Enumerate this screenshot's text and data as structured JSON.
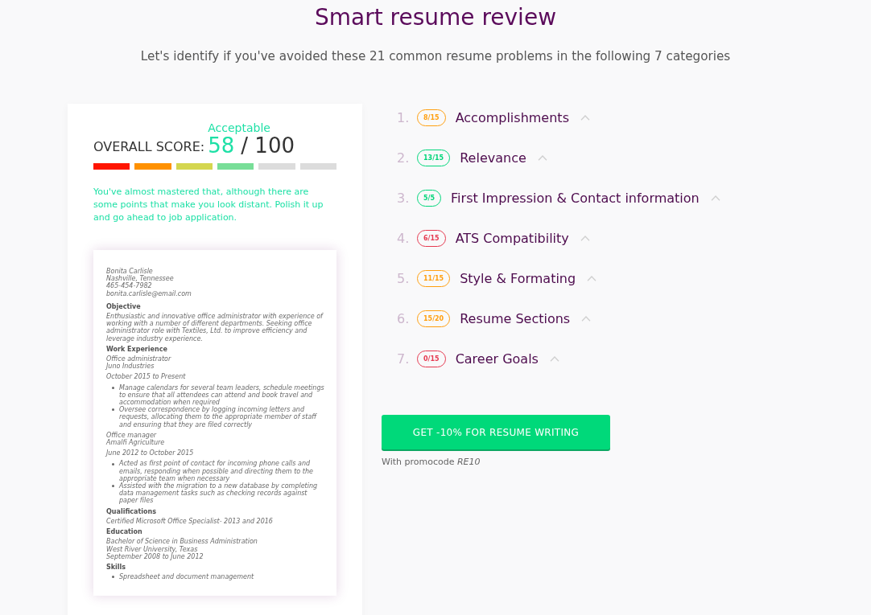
{
  "header": {
    "title": "Smart resume review",
    "subtitle": "Let's identify if you've avoided these 21 common resume problems in the following 7 categories"
  },
  "score": {
    "label": "OVERALL SCORE:",
    "rating": "Acceptable",
    "value": "58",
    "max": "/ 100",
    "segments": [
      {
        "color": "#ff1500"
      },
      {
        "color": "#ff9100"
      },
      {
        "color": "#d4d64f"
      },
      {
        "color": "#78de98"
      },
      {
        "color": "#dcdcdc"
      },
      {
        "color": "#dcdcdc"
      }
    ],
    "description": "You've almost mastered that, although there are some points that make you look distant. Polish it up and go ahead to job application."
  },
  "resume": {
    "contact": [
      "Bonita Carlisle",
      "Nashville, Tennessee",
      "465-454-7982",
      "bonita.carlisle@email.com"
    ],
    "sections": [
      {
        "heading": "Objective",
        "blocks": [
          {
            "kind": "paragraph",
            "text": "Enthusiastic and innovative office administrator with experience of working with a number of different departments. Seeking office administrator role with Textiles, Ltd. to improve efficiency and leverage industry experience."
          }
        ]
      },
      {
        "heading": "Work Experience",
        "blocks": [
          {
            "kind": "lines",
            "lines": [
              "Office administrator",
              "Juno Industries"
            ]
          },
          {
            "kind": "lines",
            "lines": [
              "October 2015 to Present"
            ]
          },
          {
            "kind": "bullets",
            "items": [
              "Manage calendars for several team leaders, schedule meetings to ensure that all attendees can attend and book travel and accommodation when required",
              "Oversee correspondence by logging incoming letters and requests, allocating them to the appropriate member of staff and ensuring that they are filed correctly"
            ]
          },
          {
            "kind": "lines",
            "lines": [
              "Office manager",
              "Amalfi Agriculture"
            ]
          },
          {
            "kind": "lines",
            "lines": [
              "June 2012 to October 2015"
            ]
          },
          {
            "kind": "bullets",
            "items": [
              "Acted as first point of contact for incoming phone calls and emails, responding when possible and directing them to the appropriate team when necessary",
              "Assisted with the migration to a new database by completing data management tasks such as checking records against paper files"
            ]
          }
        ]
      },
      {
        "heading": "Qualifications",
        "blocks": [
          {
            "kind": "lines",
            "lines": [
              "Certified Microsoft Office Specialist- 2013 and 2016"
            ]
          }
        ]
      },
      {
        "heading": "Education",
        "blocks": [
          {
            "kind": "lines",
            "lines": [
              "Bachelor of Science in Business Administration",
              "West River University, Texas",
              "September 2008 to June 2012"
            ]
          }
        ]
      },
      {
        "heading": "Skills",
        "blocks": [
          {
            "kind": "bullets",
            "items": [
              "Spreadsheet and document management"
            ]
          }
        ]
      }
    ]
  },
  "categories": [
    {
      "number": "1.",
      "score": "8/15",
      "color": "#ff9f0f",
      "label": "Accomplishments"
    },
    {
      "number": "2.",
      "score": "13/15",
      "color": "#00d67a",
      "label": "Relevance"
    },
    {
      "number": "3.",
      "score": "5/5",
      "color": "#00d67a",
      "label": "First Impression & Contact information"
    },
    {
      "number": "4.",
      "score": "6/15",
      "color": "#e63950",
      "label": "ATS Compatibility"
    },
    {
      "number": "5.",
      "score": "11/15",
      "color": "#ff9f0f",
      "label": "Style & Formating"
    },
    {
      "number": "6.",
      "score": "15/20",
      "color": "#ff9f0f",
      "label": "Resume Sections"
    },
    {
      "number": "7.",
      "score": "0/15",
      "color": "#e63950",
      "label": "Career Goals"
    }
  ],
  "cta": {
    "button": "GET -10% FOR RESUME WRITING",
    "note": "With promocode *RE10*"
  }
}
